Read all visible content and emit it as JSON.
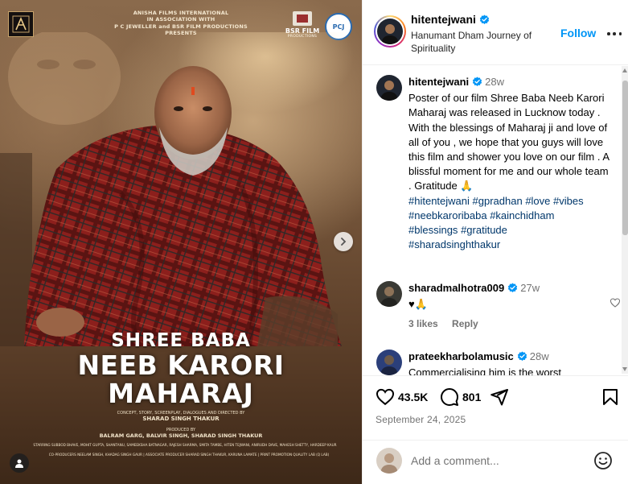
{
  "poster": {
    "credit_lines": [
      "ANISHA FILMS INTERNATIONAL",
      "IN ASSOCIATION WITH",
      "P C JEWELLER and BSR FILM PRODUCTIONS",
      "PRESENTS"
    ],
    "bsr_name": "BSR FILM",
    "bsr_sub": "PRODUCTIONS",
    "pcj_label": "PCJ",
    "title_line1": "SHREE BABA",
    "title_line2": "NEEB KARORI",
    "title_line3": "MAHARAJ",
    "director_label": "CONCEPT, STORY, SCREENPLAY, DIALOGUES AND DIRECTED BY",
    "director": "SHARAD SINGH THAKUR",
    "producer_label": "PRODUCED BY",
    "producer": "BALRAM GARG, BALVIR SINGH, SHARAD SINGH THAKUR",
    "cast": "STARRING SUBBOD BHAVE, MOHIT GUPTA, SHANTANU, SAMEEKSHA BATNAGAR, RAJESH SHARMA, SMITA TAMBE, HITEN TEJWANI, ANIRUDH DAVE, MAHESH SHETTY, HARDEEP KAUR",
    "crew": "CO-PRODUCERS NEELAM SINGH, KHADAG SINGH GAUR | ASSOCIATE PRODUCER SHARAD SINGH THAKUR, KARUNA LAMATE | PRINT PROMOTION QUALITY LAB (Q LAB)"
  },
  "header": {
    "username": "hitentejwani",
    "location": "Hanumant Dham Journey of Spirituality",
    "follow_label": "Follow"
  },
  "caption": {
    "username": "hitentejwani",
    "time": "28w",
    "body": "Poster  of our film  Shree Baba Neeb Karori Maharaj was released in Lucknow today . With the blessings of Maharaj ji and love of all of you , we hope that you guys will love this film and shower you love on our film . A blissful moment for me and our whole team . Gratitude 🙏",
    "hashtags": [
      "#hitentejwani",
      "#gpradhan",
      "#love",
      "#vibes",
      "#neebkaroribaba",
      "#kainchidham",
      "#blessings",
      "#gratitude",
      "#sharadsinghthakur"
    ]
  },
  "comments": [
    {
      "username": "sharadmalhotra009",
      "time": "27w",
      "text": "♥🙏",
      "likes_label": "3 likes",
      "reply_label": "Reply"
    },
    {
      "username": "prateekharbolamusic",
      "time": "28w",
      "text": "Commercialising him is the worst"
    }
  ],
  "actions": {
    "likes": "43.5K",
    "comments": "801"
  },
  "date": "September 24, 2025",
  "add_comment": {
    "placeholder": "Add a comment..."
  },
  "colors": {
    "link_blue": "#0095f6",
    "hashtag": "#00376b",
    "muted": "#737373",
    "verified": "#0095f6"
  }
}
